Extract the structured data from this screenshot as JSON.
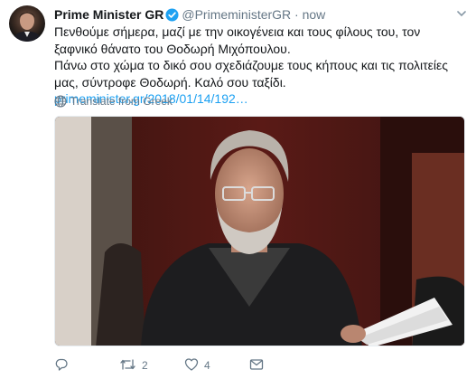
{
  "tweet": {
    "name": "Prime Minister GR",
    "handle": "@PrimeministerGR",
    "separator": "·",
    "time": "now",
    "line1": "Πενθούμε σήμερα, μαζί με την οικογένεια και τους φίλους του, τον ξαφνικό θάνατο του Θοδωρή Μιχόπουλου.",
    "line2_text": "Πάνω στο χώμα το δικό σου σχεδιάζουμε τους κήπους και τις πολιτείες μας, σύντροφε Θοδωρή. Καλό σου ταξίδι.",
    "link": "primeminister.gr/2018/01/14/192…",
    "translate": "Translate from Greek"
  },
  "actions": {
    "reply_count": "",
    "retweet_count": "2",
    "like_count": "4"
  },
  "colors": {
    "accent": "#1da1f2",
    "secondary_text": "#657786",
    "primary_text": "#14171a"
  },
  "icons": [
    "avatar",
    "verified-badge-icon",
    "chevron-down-icon",
    "globe-icon",
    "reply-icon",
    "retweet-icon",
    "like-icon",
    "direct-message-icon"
  ]
}
